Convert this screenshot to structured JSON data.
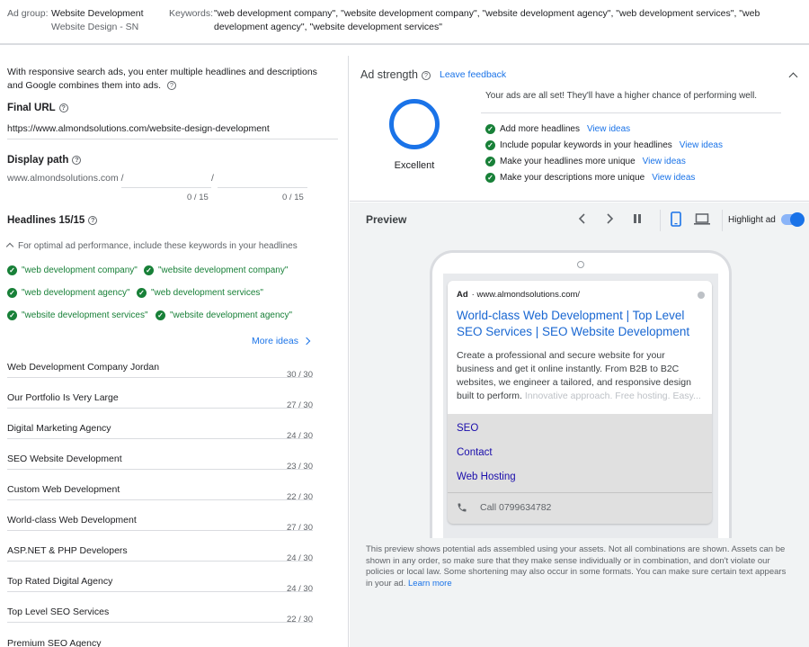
{
  "topbar": {
    "ad_group_label": "Ad group:",
    "ad_group_name": "Website Development",
    "ad_group_sub": "Website Design - SN",
    "keywords_label": "Keywords:",
    "keywords_value": "\"web development company\", \"website development company\", \"website development agency\", \"web development services\", \"web development agency\", \"website development services\""
  },
  "left": {
    "intro": "With responsive search ads, you enter multiple headlines and descriptions and Google combines them into ads.",
    "final_url_title": "Final URL",
    "final_url_value": "https://www.almondsolutions.com/website-design-development",
    "display_path_title": "Display path",
    "display_path_base": "www.almondsolutions.com /",
    "path_sep": "/",
    "path1_count": "0 / 15",
    "path2_count": "0 / 15",
    "headlines_title": "Headlines 15/15",
    "keyword_hint": "For optimal ad performance, include these keywords in your headlines",
    "keywords": [
      "\"web development company\"",
      "\"website development company\"",
      "\"web development agency\"",
      "\"web development services\"",
      "\"website development services\"",
      "\"website development agency\""
    ],
    "more_ideas": "More ideas",
    "headlines": [
      {
        "text": "Web Development Company Jordan",
        "count": ""
      },
      {
        "text": "Our Portfolio Is Very Large",
        "count": "30 / 30"
      },
      {
        "text": "Digital Marketing Agency",
        "count": "27 / 30"
      },
      {
        "text": "SEO Website Development",
        "count": "24 / 30"
      },
      {
        "text": "Custom Web Development",
        "count": "23 / 30"
      },
      {
        "text": "World-class Web Development",
        "count": "22 / 30"
      },
      {
        "text": "ASP.NET & PHP Developers",
        "count": "27 / 30"
      },
      {
        "text": "Top Rated Digital Agency",
        "count": "24 / 30"
      },
      {
        "text": "Top Level SEO Services",
        "count": "24 / 30"
      },
      {
        "text": "Premium SEO Agency",
        "count": "22 / 30"
      }
    ]
  },
  "strength": {
    "title": "Ad strength",
    "leave_feedback": "Leave feedback",
    "rating": "Excellent",
    "all_set": "Your ads are all set! They'll have a higher chance of performing well.",
    "suggestions": [
      {
        "text": "Add more headlines",
        "link": "View ideas"
      },
      {
        "text": "Include popular keywords in your headlines",
        "link": "View ideas"
      },
      {
        "text": "Make your headlines more unique",
        "link": "View ideas"
      },
      {
        "text": "Make your descriptions more unique",
        "link": "View ideas"
      }
    ],
    "ring_color": "#1a73e8"
  },
  "preview": {
    "title": "Preview",
    "highlight_label": "Highlight ad",
    "highlight_on": true,
    "ad_label": "Ad",
    "ad_url": "www.almondsolutions.com/",
    "ad_headline": "World-class Web Development | Top Level SEO Services | SEO Website Development",
    "ad_description": "Create a professional and secure website for your business and get it online instantly. From B2B to B2C websites, we engineer a tailored, and responsive design built to perform.",
    "ad_description_fade": "Innovative approach. Free hosting. Easy...",
    "sitelinks": [
      "SEO",
      "Contact",
      "Web Hosting"
    ],
    "call": "Call 0799634782",
    "disclaimer": "This preview shows potential ads assembled using your assets. Not all combinations are shown. Assets can be shown in any order, so make sure that they make sense individually or in combination, and don't violate our policies or local law. Some shortening may also occur in some formats. You can make sure certain text appears in your ad.",
    "learn_more": "Learn more"
  }
}
